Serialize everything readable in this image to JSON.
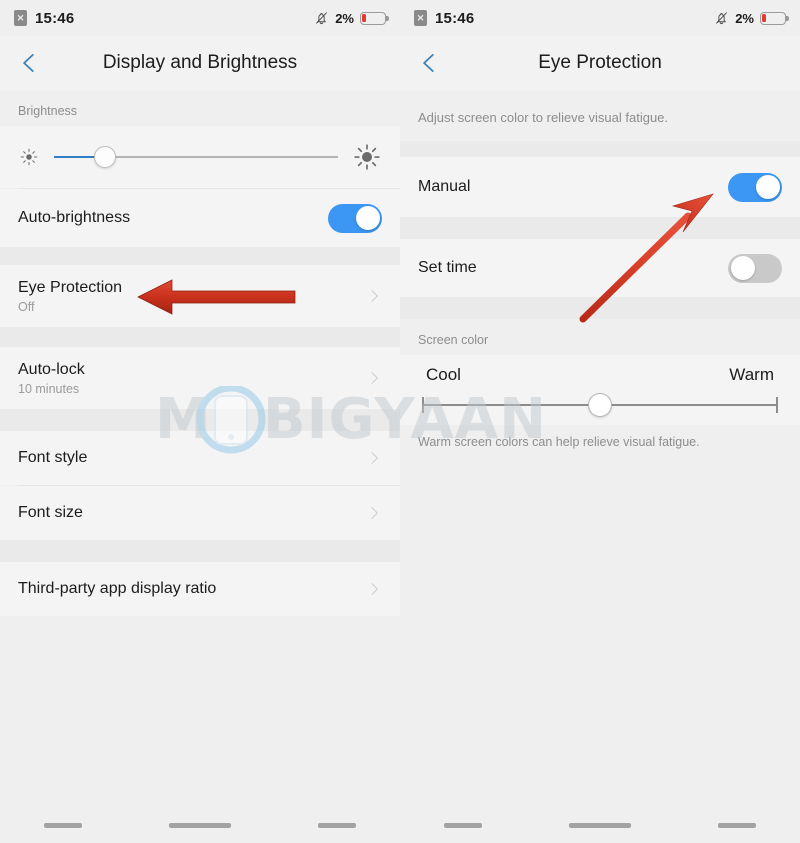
{
  "status_bar": {
    "sim_icon": "sim-x-icon",
    "time": "15:46",
    "bell_icon": "bell-muted-icon",
    "battery_percent": "2%",
    "battery_icon": "battery-low-icon"
  },
  "colors": {
    "accent_blue": "#3b97f3",
    "slider_blue": "#2e7fc4",
    "arrow_red": "#d0321f",
    "battery_red": "#e23b2e",
    "page_bg": "#efefef",
    "card_bg": "#f4f4f4",
    "gap_bg": "#eaeaea"
  },
  "left_screen": {
    "back_icon": "back-chevron-icon",
    "title": "Display and Brightness",
    "brightness_section_label": "Brightness",
    "brightness_slider": {
      "low_icon": "brightness-low-icon",
      "high_icon": "brightness-high-icon",
      "value_percent": 18
    },
    "rows": [
      {
        "title": "Auto-brightness",
        "sub": "",
        "control": "toggle",
        "toggle_state": "on"
      },
      {
        "title": "Eye Protection",
        "sub": "Off",
        "control": "chevron"
      },
      {
        "title": "Auto-lock",
        "sub": "10 minutes",
        "control": "chevron"
      },
      {
        "title": "Font style",
        "sub": "",
        "control": "chevron"
      },
      {
        "title": "Font size",
        "sub": "",
        "control": "chevron"
      },
      {
        "title": "Third-party app display ratio",
        "sub": "",
        "control": "chevron"
      }
    ],
    "annotation_arrow": "red-left-arrow-pointing-to-eye-protection"
  },
  "right_screen": {
    "back_icon": "back-chevron-icon",
    "title": "Eye Protection",
    "description": "Adjust screen color to relieve visual fatigue.",
    "rows": [
      {
        "title": "Manual",
        "control": "toggle",
        "toggle_state": "on"
      },
      {
        "title": "Set time",
        "control": "toggle",
        "toggle_state": "off"
      }
    ],
    "screen_color_label": "Screen color",
    "screen_color_slider": {
      "min_label": "Cool",
      "max_label": "Warm",
      "value_percent": 50
    },
    "hint": "Warm screen colors can help relieve visual fatigue.",
    "annotation_arrow": "red-diagonal-arrow-pointing-to-manual-toggle"
  },
  "nav_bar": {
    "recents_icon": "recents-bar",
    "home_icon": "home-bar",
    "back_icon": "back-bar"
  },
  "watermark": {
    "text_before": "M",
    "text_after": "BIGYAAN",
    "logo_icon": "phone-logo-icon"
  }
}
